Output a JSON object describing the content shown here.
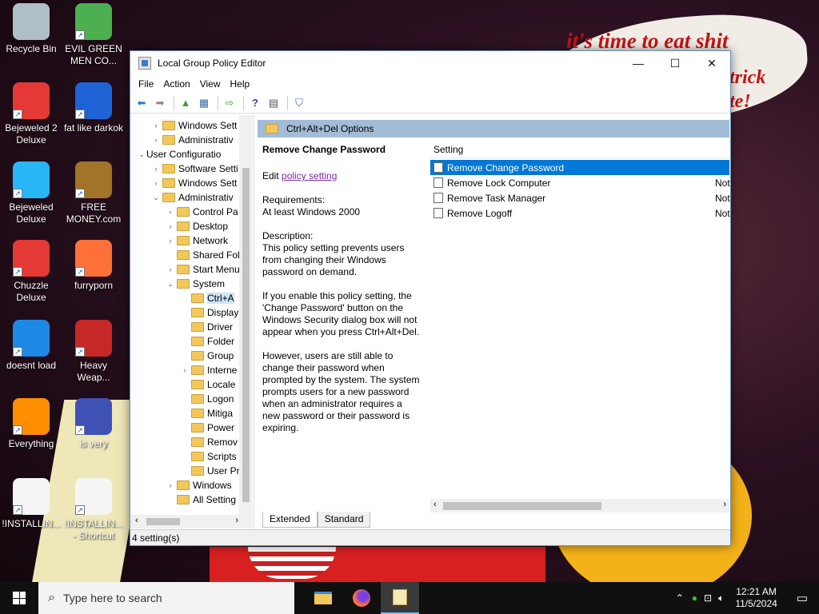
{
  "desktop": {
    "wallpaper_text": [
      "it's time to eat shit",
      "trick",
      "te!"
    ],
    "icons": [
      {
        "label": "Recycle Bin",
        "icon": "recycle-bin-icon"
      },
      {
        "label": "EVIL GREEN MEN CO...",
        "icon": "green-men-icon"
      },
      {
        "label": "Bejeweled 2 Deluxe",
        "icon": "bejeweled2-icon"
      },
      {
        "label": "fat like darkok",
        "icon": "mpl-icon"
      },
      {
        "label": "Bejeweled Deluxe",
        "icon": "diamond-icon"
      },
      {
        "label": "FREE MONEY.com",
        "icon": "money-bag-icon"
      },
      {
        "label": "Chuzzle Deluxe",
        "icon": "chuzzle-icon"
      },
      {
        "label": "furryporn",
        "icon": "firefox-icon"
      },
      {
        "label": "doesnt load",
        "icon": "thunderbird-icon"
      },
      {
        "label": "Heavy Weap...",
        "icon": "radiation-icon"
      },
      {
        "label": "Everything",
        "icon": "everything-icon"
      },
      {
        "label": "is very",
        "icon": "mpl-shield-icon"
      },
      {
        "label": "!INSTALLIN...",
        "icon": "document-icon"
      },
      {
        "label": "!INSTALLIN... - Shortcut",
        "icon": "document-shortcut-icon"
      }
    ]
  },
  "window": {
    "title": "Local Group Policy Editor",
    "menu": [
      "File",
      "Action",
      "View",
      "Help"
    ],
    "tree": [
      {
        "label": "Windows Sett",
        "exp": "›",
        "indent": 0
      },
      {
        "label": "Administrativ",
        "exp": "›",
        "indent": 0
      },
      {
        "label": "User Configuratio",
        "exp": "⌄",
        "indent": -1
      },
      {
        "label": "Software Setti",
        "exp": "›",
        "indent": 0
      },
      {
        "label": "Windows Sett",
        "exp": "›",
        "indent": 0
      },
      {
        "label": "Administrativ",
        "exp": "⌄",
        "indent": 0
      },
      {
        "label": "Control Pa",
        "exp": "›",
        "indent": 1
      },
      {
        "label": "Desktop",
        "exp": "›",
        "indent": 1
      },
      {
        "label": "Network",
        "exp": "›",
        "indent": 1
      },
      {
        "label": "Shared Fol",
        "exp": "",
        "indent": 1
      },
      {
        "label": "Start Menu",
        "exp": "›",
        "indent": 1
      },
      {
        "label": "System",
        "exp": "⌄",
        "indent": 1
      },
      {
        "label": "Ctrl+A",
        "exp": "",
        "indent": 2
      },
      {
        "label": "Display",
        "exp": "",
        "indent": 2
      },
      {
        "label": "Driver",
        "exp": "",
        "indent": 2
      },
      {
        "label": "Folder",
        "exp": "",
        "indent": 2
      },
      {
        "label": "Group",
        "exp": "",
        "indent": 2
      },
      {
        "label": "Interne",
        "exp": "›",
        "indent": 2
      },
      {
        "label": "Locale",
        "exp": "",
        "indent": 2
      },
      {
        "label": "Logon",
        "exp": "",
        "indent": 2
      },
      {
        "label": "Mitiga",
        "exp": "",
        "indent": 2
      },
      {
        "label": "Power",
        "exp": "",
        "indent": 2
      },
      {
        "label": "Remov",
        "exp": "",
        "indent": 2
      },
      {
        "label": "Scripts",
        "exp": "",
        "indent": 2
      },
      {
        "label": "User Pr",
        "exp": "",
        "indent": 2
      },
      {
        "label": "Windows",
        "exp": "›",
        "indent": 1
      },
      {
        "label": "All Setting",
        "exp": "",
        "indent": 1
      }
    ],
    "node_header": "Ctrl+Alt+Del Options",
    "description": {
      "heading": "Remove Change Password",
      "edit_prefix": "Edit",
      "edit_link": "policy setting",
      "requirements_label": "Requirements:",
      "requirements": "At least Windows 2000",
      "description_label": "Description:",
      "description": "This policy setting prevents users from changing their Windows password on demand.",
      "if_enable": "If you enable this policy setting, the 'Change Password' button on the Windows Security dialog box will not appear when you press Ctrl+Alt+Del.",
      "however": "However, users are still able to change their password when prompted by the system. The system prompts users for a new password when an administrator requires a new password or their password is expiring."
    },
    "list_header": "Setting",
    "settings": [
      {
        "name": "Remove Change Password",
        "state": ""
      },
      {
        "name": "Remove Lock Computer",
        "state": "Not"
      },
      {
        "name": "Remove Task Manager",
        "state": "Not"
      },
      {
        "name": "Remove Logoff",
        "state": "Not"
      }
    ],
    "tabs": [
      "Extended",
      "Standard"
    ],
    "status": "4 setting(s)"
  },
  "taskbar": {
    "search_placeholder": "Type here to search",
    "time": "12:21 AM",
    "date": "11/5/2024"
  }
}
